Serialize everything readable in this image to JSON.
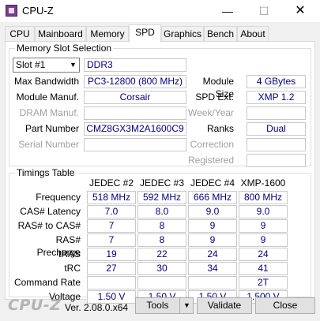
{
  "window": {
    "title": "CPU-Z",
    "min_glyph": "—",
    "max_glyph": "☐",
    "close_glyph": "✕"
  },
  "tabs": [
    "CPU",
    "Mainboard",
    "Memory",
    "SPD",
    "Graphics",
    "Bench",
    "About"
  ],
  "active_tab": "SPD",
  "slot_selection": {
    "title": "Memory Slot Selection",
    "slot": "Slot #1",
    "memory_type": "DDR3",
    "labels": {
      "max_bandwidth": "Max Bandwidth",
      "module_manuf": "Module Manuf.",
      "dram_manuf": "DRAM Manuf.",
      "part_number": "Part Number",
      "serial_number": "Serial Number",
      "module_size": "Module Size",
      "spd_ext": "SPD Ext.",
      "week_year": "Week/Year",
      "ranks": "Ranks",
      "correction": "Correction",
      "registered": "Registered"
    },
    "values": {
      "max_bandwidth": "PC3-12800 (800 MHz)",
      "module_manuf": "Corsair",
      "dram_manuf": "",
      "part_number": "CMZ8GX3M2A1600C9",
      "serial_number": "",
      "module_size": "4 GBytes",
      "spd_ext": "XMP 1.2",
      "week_year": "",
      "ranks": "Dual",
      "correction": "",
      "registered": ""
    }
  },
  "timings": {
    "title": "Timings Table",
    "columns": [
      "JEDEC #2",
      "JEDEC #3",
      "JEDEC #4",
      "XMP-1600"
    ],
    "rows": [
      {
        "label": "Frequency",
        "values": [
          "518 MHz",
          "592 MHz",
          "666 MHz",
          "800 MHz"
        ]
      },
      {
        "label": "CAS# Latency",
        "values": [
          "7.0",
          "8.0",
          "9.0",
          "9.0"
        ]
      },
      {
        "label": "RAS# to CAS#",
        "values": [
          "7",
          "8",
          "9",
          "9"
        ]
      },
      {
        "label": "RAS# Precharge",
        "values": [
          "7",
          "8",
          "9",
          "9"
        ]
      },
      {
        "label": "tRAS",
        "values": [
          "19",
          "22",
          "24",
          "24"
        ]
      },
      {
        "label": "tRC",
        "values": [
          "27",
          "30",
          "34",
          "41"
        ]
      },
      {
        "label": "Command Rate",
        "values": [
          "",
          "",
          "",
          "2T"
        ]
      },
      {
        "label": "Voltage",
        "values": [
          "1.50 V",
          "1.50 V",
          "1.50 V",
          "1.500 V"
        ]
      }
    ]
  },
  "footer": {
    "logo": "CPU-Z",
    "version": "Ver. 2.08.0.x64",
    "tools_label": "Tools",
    "validate_label": "Validate",
    "close_label": "Close",
    "dropdown_glyph": "▼"
  }
}
